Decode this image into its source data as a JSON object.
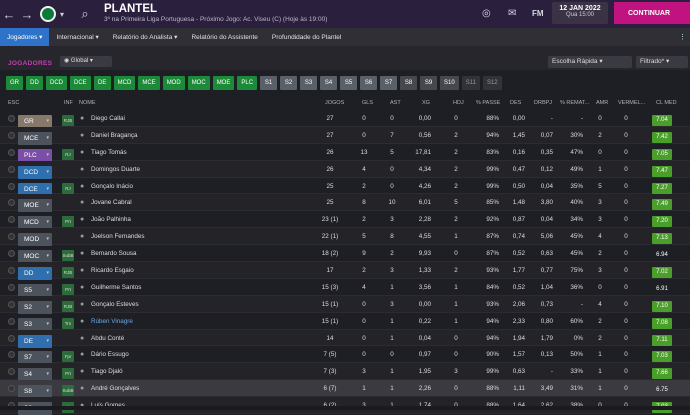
{
  "header": {
    "title": "PLANTEL",
    "subtitle": "3º na Primeira Liga Portuguesa - Próximo Jogo: Ac. Viseu (C) (Hoje às 19:00)",
    "date_line1": "12 JAN 2022",
    "date_line2": "Qua 15:00",
    "continue_label": "CONTINUAR",
    "fm_label": "FM"
  },
  "tabs": [
    {
      "label": "Jogadores ▾"
    },
    {
      "label": "Internacional ▾"
    },
    {
      "label": "Relatório do Analista ▾"
    },
    {
      "label": "Relatório do Assistente"
    },
    {
      "label": "Profundidade do Plantel"
    }
  ],
  "section": {
    "label": "JOGADORES",
    "global": "Global",
    "quick": "Escolha Rápida",
    "filter": "Filtrado*"
  },
  "chips": [
    "GR",
    "DD",
    "DCD",
    "DCE",
    "DE",
    "MCD",
    "MCE",
    "MOD",
    "MOC",
    "MOE",
    "PLC",
    "S1",
    "S2",
    "S3",
    "S4",
    "S5",
    "S6",
    "S7",
    "S8",
    "S9",
    "S10",
    "S11",
    "S12"
  ],
  "columns": {
    "esc": "ESC",
    "inf": "INF",
    "nome": "NOME",
    "jogos": "JOGOS",
    "gls": "GLS",
    "ast": "AST",
    "xg": "XG",
    "hdj": "HDJ",
    "passe": "% PASSE",
    "des": "DES",
    "drbpj": "DRBPJ",
    "remate": "% REMAT...",
    "amr": "AMR",
    "vermel": "VERMEL...",
    "clmed": "CL MED"
  },
  "players": [
    {
      "pos": "GR",
      "inf": "RJB",
      "nome": "Diego Callai",
      "jogos": "27",
      "gls": "0",
      "ast": "0",
      "xg": "0,00",
      "hdj": "0",
      "passe": "88%",
      "des": "0,00",
      "drbpj": "-",
      "remate": "-",
      "amr": "0",
      "vermel": "0",
      "cl": "7.04"
    },
    {
      "pos": "MCE",
      "inf": "",
      "nome": "Daniel Bragança",
      "jogos": "27",
      "gls": "0",
      "ast": "7",
      "xg": "0,56",
      "hdj": "2",
      "passe": "94%",
      "des": "1,45",
      "drbpj": "0,07",
      "remate": "30%",
      "amr": "2",
      "vermel": "0",
      "cl": "7.42"
    },
    {
      "pos": "PLC",
      "inf": "RJ",
      "nome": "Tiago Tomás",
      "jogos": "26",
      "gls": "13",
      "ast": "5",
      "xg": "17,81",
      "hdj": "2",
      "passe": "83%",
      "des": "0,16",
      "drbpj": "0,35",
      "remate": "47%",
      "amr": "0",
      "vermel": "0",
      "cl": "7.05"
    },
    {
      "pos": "DCD",
      "inf": "",
      "nome": "Domingos Duarte",
      "jogos": "26",
      "gls": "4",
      "ast": "0",
      "xg": "4,34",
      "hdj": "2",
      "passe": "99%",
      "des": "0,47",
      "drbpj": "0,12",
      "remate": "49%",
      "amr": "1",
      "vermel": "0",
      "cl": "7.47"
    },
    {
      "pos": "DCE",
      "inf": "RJ",
      "nome": "Gonçalo Inácio",
      "jogos": "25",
      "gls": "2",
      "ast": "0",
      "xg": "4,26",
      "hdj": "2",
      "passe": "99%",
      "des": "0,50",
      "drbpj": "0,04",
      "remate": "35%",
      "amr": "5",
      "vermel": "0",
      "cl": "7.27"
    },
    {
      "pos": "MOE",
      "inf": "",
      "nome": "Jovane Cabral",
      "jogos": "25",
      "gls": "8",
      "ast": "10",
      "xg": "6,01",
      "hdj": "5",
      "passe": "85%",
      "des": "1,48",
      "drbpj": "3,80",
      "remate": "40%",
      "amr": "3",
      "vermel": "0",
      "cl": "7.49"
    },
    {
      "pos": "MCD",
      "inf": "Prt",
      "nome": "João Palhinha",
      "jogos": "23 (1)",
      "gls": "2",
      "ast": "3",
      "xg": "2,28",
      "hdj": "2",
      "passe": "92%",
      "des": "0,87",
      "drbpj": "0,04",
      "remate": "34%",
      "amr": "3",
      "vermel": "0",
      "cl": "7.20"
    },
    {
      "pos": "MOD",
      "inf": "",
      "nome": "Joelson Fernandes",
      "jogos": "22 (1)",
      "gls": "5",
      "ast": "8",
      "xg": "4,55",
      "hdj": "1",
      "passe": "87%",
      "des": "0,74",
      "drbpj": "5,06",
      "remate": "45%",
      "amr": "4",
      "vermel": "0",
      "cl": "7.13"
    },
    {
      "pos": "MOC",
      "inf": "SubB",
      "nome": "Bernardo Sousa",
      "jogos": "18 (2)",
      "gls": "9",
      "ast": "2",
      "xg": "9,93",
      "hdj": "0",
      "passe": "87%",
      "des": "0,52",
      "drbpj": "0,63",
      "remate": "45%",
      "amr": "2",
      "vermel": "0",
      "cl": "6.94"
    },
    {
      "pos": "DD",
      "inf": "RJB",
      "nome": "Ricardo Esgaio",
      "jogos": "17",
      "gls": "2",
      "ast": "3",
      "xg": "1,33",
      "hdj": "2",
      "passe": "93%",
      "des": "1,77",
      "drbpj": "0,77",
      "remate": "75%",
      "amr": "3",
      "vermel": "0",
      "cl": "7.02"
    },
    {
      "pos": "S5",
      "inf": "Prt",
      "nome": "Guilherme Santos",
      "jogos": "15 (3)",
      "gls": "4",
      "ast": "1",
      "xg": "3,56",
      "hdj": "1",
      "passe": "84%",
      "des": "0,52",
      "drbpj": "1,04",
      "remate": "36%",
      "amr": "0",
      "vermel": "0",
      "cl": "6.91"
    },
    {
      "pos": "S2",
      "inf": "RJB",
      "nome": "Gonçalo Esteves",
      "jogos": "15 (1)",
      "gls": "0",
      "ast": "3",
      "xg": "0,00",
      "hdj": "1",
      "passe": "93%",
      "des": "2,06",
      "drbpj": "0,73",
      "remate": "-",
      "amr": "4",
      "vermel": "0",
      "cl": "7.10"
    },
    {
      "pos": "S3",
      "inf": "Trn",
      "nome": "Rúben Vinagre",
      "jogos": "15 (1)",
      "gls": "0",
      "ast": "1",
      "xg": "0,22",
      "hdj": "1",
      "passe": "94%",
      "des": "2,33",
      "drbpj": "0,80",
      "remate": "60%",
      "amr": "2",
      "vermel": "0",
      "cl": "7.08"
    },
    {
      "pos": "DE",
      "inf": "",
      "nome": "Abdu Conté",
      "jogos": "14",
      "gls": "0",
      "ast": "1",
      "xg": "0,04",
      "hdj": "0",
      "passe": "94%",
      "des": "1,94",
      "drbpj": "1,79",
      "remate": "0%",
      "amr": "2",
      "vermel": "0",
      "cl": "7.11"
    },
    {
      "pos": "S7",
      "inf": "Fpr",
      "nome": "Dário Essugo",
      "jogos": "7 (5)",
      "gls": "0",
      "ast": "0",
      "xg": "0,97",
      "hdj": "0",
      "passe": "90%",
      "des": "1,57",
      "drbpj": "0,13",
      "remate": "50%",
      "amr": "1",
      "vermel": "0",
      "cl": "7.03"
    },
    {
      "pos": "S4",
      "inf": "Prt",
      "nome": "Tiago Djaló",
      "jogos": "7 (3)",
      "gls": "3",
      "ast": "1",
      "xg": "1,95",
      "hdj": "3",
      "passe": "99%",
      "des": "0,63",
      "drbpj": "-",
      "remate": "33%",
      "amr": "1",
      "vermel": "0",
      "cl": "7.66"
    },
    {
      "pos": "S8",
      "inf": "SubB",
      "nome": "André Gonçalves",
      "jogos": "6 (7)",
      "gls": "1",
      "ast": "1",
      "xg": "2,26",
      "hdj": "0",
      "passe": "88%",
      "des": "1,11",
      "drbpj": "3,49",
      "remate": "31%",
      "amr": "1",
      "vermel": "0",
      "cl": "6.75"
    },
    {
      "pos": "S6",
      "inf": "SubB",
      "nome": "Luís Gomes",
      "jogos": "6 (2)",
      "gls": "3",
      "ast": "1",
      "xg": "1,74",
      "hdj": "0",
      "passe": "88%",
      "des": "1,64",
      "drbpj": "2,62",
      "remate": "38%",
      "amr": "0",
      "vermel": "0",
      "cl": "7.03"
    }
  ],
  "colors": {
    "accent": "#c0137f",
    "green": "#1d8a3a",
    "clgreen": "#4a9e2a",
    "tab": "#2e73c9"
  }
}
